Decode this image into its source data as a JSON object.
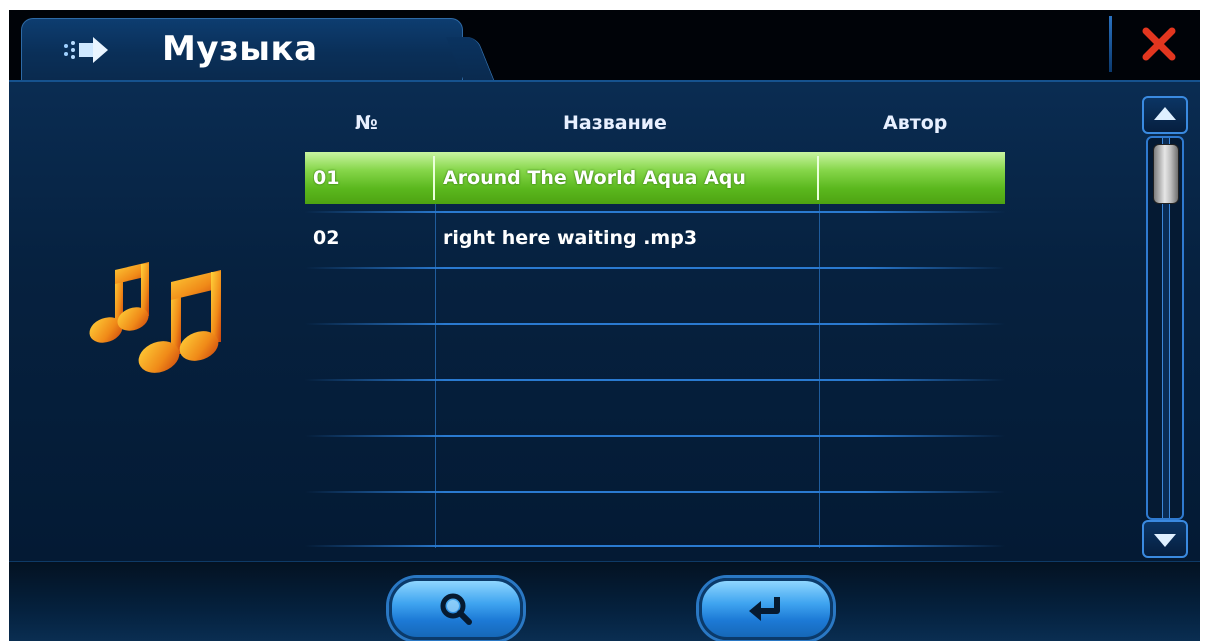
{
  "window": {
    "title": "Музыка"
  },
  "table": {
    "headers": {
      "number": "№",
      "name": "Название",
      "author": "Автор"
    },
    "rows": [
      {
        "number": "01",
        "name": "Around The World Aqua Aqu",
        "author": "",
        "selected": true
      },
      {
        "number": "02",
        "name": "right here waiting .mp3",
        "author": "",
        "selected": false
      }
    ]
  },
  "icons": {
    "title": "arrow-right-icon",
    "close": "close-icon",
    "music": "music-notes-icon",
    "search": "search-icon",
    "back": "return-icon",
    "scroll_up": "triangle-up-icon",
    "scroll_down": "triangle-down-icon"
  },
  "colors": {
    "selected_row": "#6cc62c",
    "close_x": "#e2361f",
    "accent_blue": "#2a7ad0"
  }
}
